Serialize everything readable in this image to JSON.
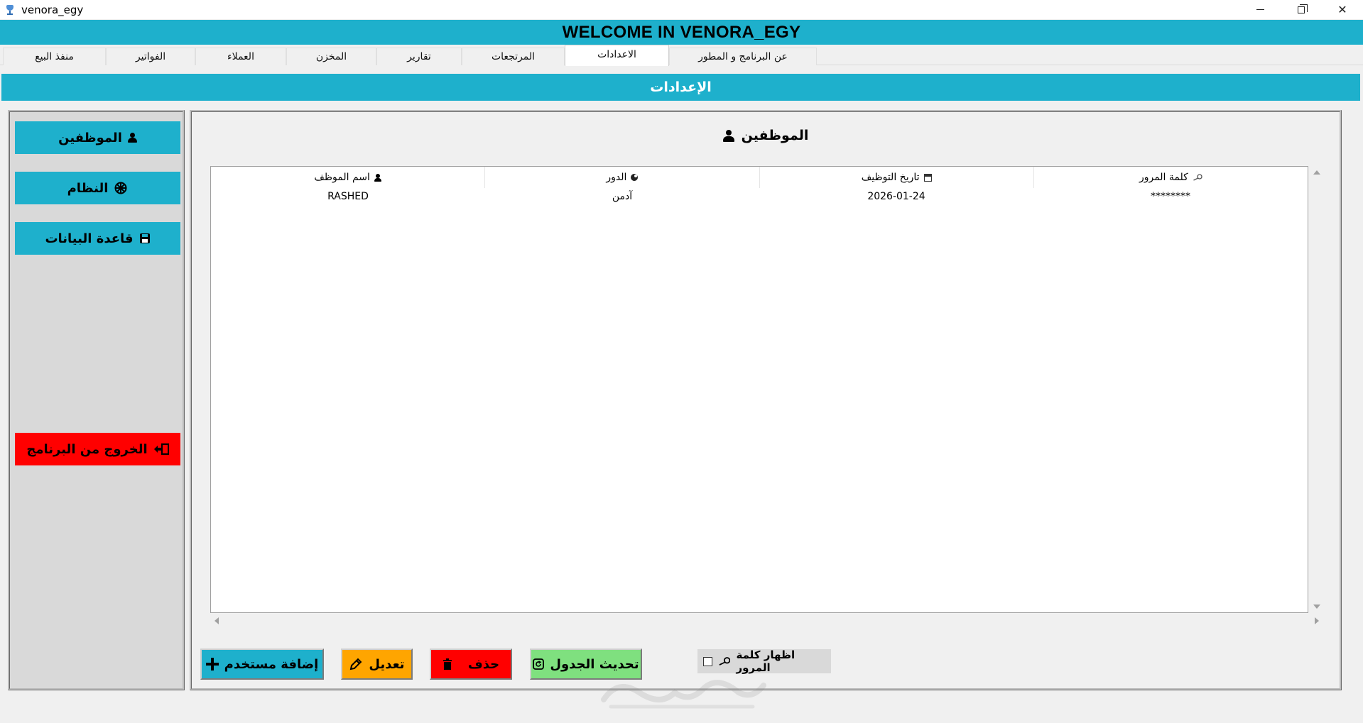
{
  "window": {
    "title": "venora_egy",
    "controls": [
      "minimize",
      "restore",
      "close"
    ],
    "close_glyph": "✕"
  },
  "banner": {
    "text": "WELCOME IN VENORA_EGY",
    "color": "#1eb0cc"
  },
  "tabs": [
    {
      "label": "منفذ البيع",
      "active": false
    },
    {
      "label": "الفواتير",
      "active": false
    },
    {
      "label": "العملاء",
      "active": false
    },
    {
      "label": "المخزن",
      "active": false
    },
    {
      "label": "تقارير",
      "active": false
    },
    {
      "label": "المرتجعات",
      "active": false
    },
    {
      "label": "الاعدادات",
      "active": true
    },
    {
      "label": "عن البرنامج و المطور",
      "active": false
    }
  ],
  "section": {
    "title": "الإعدادات"
  },
  "sidebar": {
    "items": [
      {
        "label": "الموظفين",
        "icon": "person-icon",
        "color": "#1eb0cc"
      },
      {
        "label": "النظام",
        "icon": "gear-icon",
        "color": "#1eb0cc"
      },
      {
        "label": "قاعدة البيانات",
        "icon": "database-icon",
        "color": "#1eb0cc"
      }
    ],
    "exit": {
      "label": "الخروج من البرنامج",
      "icon": "exit-icon",
      "color": "#ff0000"
    }
  },
  "employees": {
    "title": "الموظفين",
    "columns": [
      "اسم الموظف",
      "الدور",
      "تاريخ التوظيف",
      "كلمة المرور"
    ],
    "column_icons": [
      "person-icon",
      "role-icon",
      "calendar-icon",
      "key-icon"
    ],
    "rows": [
      {
        "name": "RASHED",
        "role": "آدمن",
        "hire_date": "2026-01-24",
        "password": "********"
      }
    ]
  },
  "actions": {
    "add": {
      "label": "إضافة مستخدم",
      "color": "#1eb0cc"
    },
    "edit": {
      "label": "تعديل",
      "color": "#ffa500"
    },
    "delete": {
      "label": "حذف",
      "color": "#ff0000"
    },
    "refresh": {
      "label": "تحديث الجدول",
      "color": "#7fe07f"
    }
  },
  "show_password": {
    "label": "اظهار كلمة المرور",
    "checked": false
  }
}
